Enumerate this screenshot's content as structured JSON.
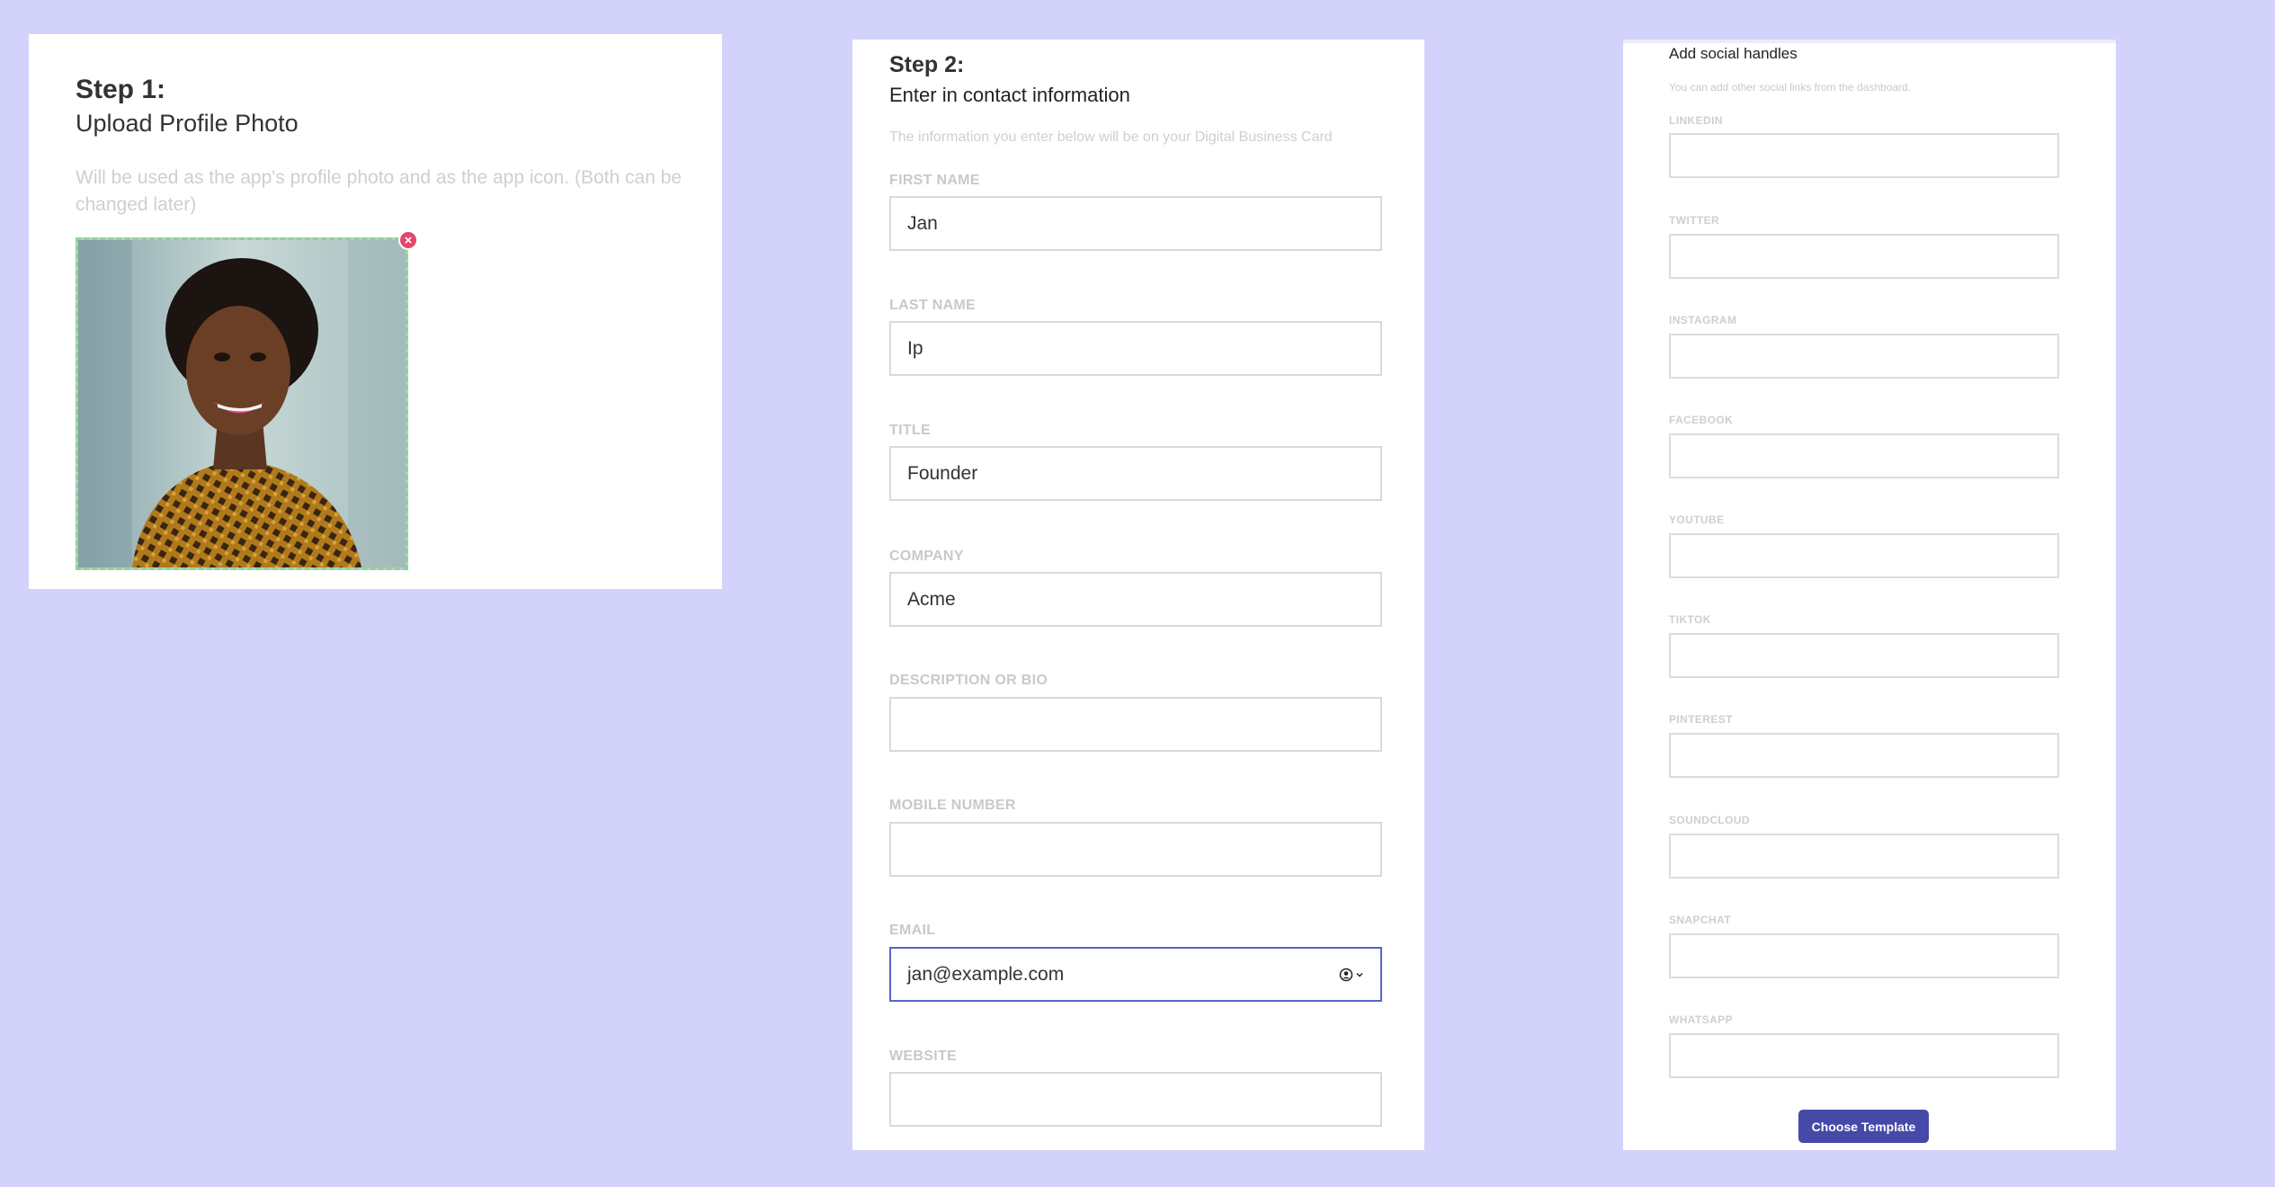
{
  "step1": {
    "heading": "Step 1:",
    "subheading": "Upload Profile Photo",
    "helper": "Will be used as the app's profile photo and as the app icon. (Both can be changed later)",
    "remove_icon_glyph": "×"
  },
  "step2": {
    "heading": "Step 2:",
    "subheading": "Enter in contact information",
    "helper": "The information you enter below will be on your Digital Business Card",
    "fields": [
      {
        "label": "FIRST NAME",
        "value": "Jan"
      },
      {
        "label": "LAST NAME",
        "value": "Ip"
      },
      {
        "label": "TITLE",
        "value": "Founder"
      },
      {
        "label": "COMPANY",
        "value": "Acme"
      },
      {
        "label": "DESCRIPTION OR BIO",
        "value": ""
      },
      {
        "label": "MOBILE NUMBER",
        "value": ""
      },
      {
        "label": "EMAIL",
        "value": "jan@example.com"
      },
      {
        "label": "WEBSITE",
        "value": ""
      }
    ]
  },
  "step3": {
    "title": "Add social handles",
    "helper": "You can add other social links from the dashboard.",
    "socials": [
      {
        "label": "LINKEDIN"
      },
      {
        "label": "TWITTER"
      },
      {
        "label": "INSTAGRAM"
      },
      {
        "label": "FACEBOOK"
      },
      {
        "label": "YOUTUBE"
      },
      {
        "label": "TIKTOK"
      },
      {
        "label": "PINTEREST"
      },
      {
        "label": "SOUNDCLOUD"
      },
      {
        "label": "SNAPCHAT"
      },
      {
        "label": "WHATSAPP"
      }
    ],
    "choose_button": "Choose Template"
  },
  "colors": {
    "background": "#d2d2fa",
    "accent": "#4749a8",
    "focus_border": "#5d63c8",
    "remove": "#e4466a",
    "dropzone_border": "#8fd48f"
  }
}
